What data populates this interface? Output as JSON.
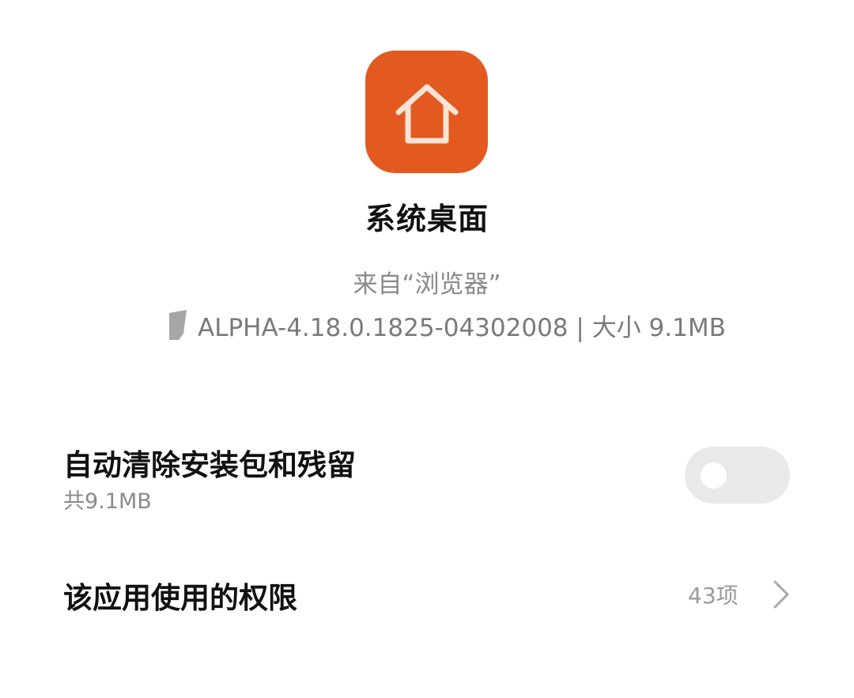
{
  "app": {
    "name": "系统桌面",
    "icon": "home-icon",
    "icon_bg_color": "#e25a20",
    "source": "来自“浏览器”",
    "version": "ALPHA-4.18.0.1825-04302008 | 大小 9.1MB"
  },
  "auto_clean": {
    "title": "自动清除安装包和残留",
    "subtitle": "共9.1MB",
    "enabled": false
  },
  "permissions": {
    "title": "该应用使用的权限",
    "count": "43项",
    "icon": "chevron-right-icon"
  }
}
